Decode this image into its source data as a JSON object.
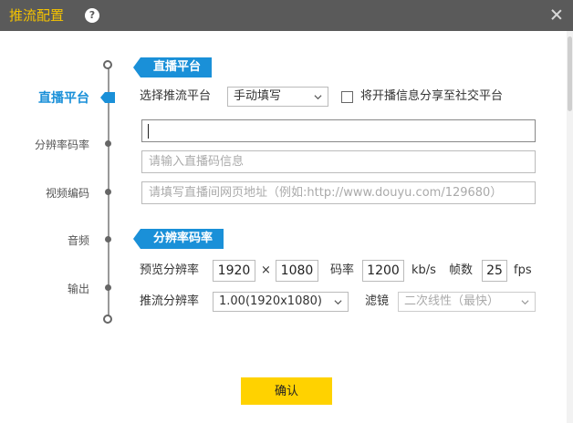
{
  "window": {
    "title": "推流配置",
    "help_glyph": "?"
  },
  "nav": {
    "items": [
      {
        "label": "直播平台",
        "active": true
      },
      {
        "label": "分辨率码率",
        "active": false
      },
      {
        "label": "视频编码",
        "active": false
      },
      {
        "label": "音频",
        "active": false
      },
      {
        "label": "输出",
        "active": false
      }
    ]
  },
  "platform_section": {
    "tag": "直播平台",
    "select_label": "选择推流平台",
    "select_value": "手动填写",
    "share_label": "将开播信息分享至社交平台",
    "share_checked": false,
    "server_input_value": "",
    "stream_key_placeholder": "请输入直播码信息",
    "room_url_placeholder": "请填写直播间网页地址（例如:http://www.douyu.com/129680）"
  },
  "resolution_section": {
    "tag": "分辨率码率",
    "preview_label": "预览分辨率",
    "preview_width": "1920",
    "times_sign": "×",
    "preview_height": "1080",
    "bitrate_label": "码率",
    "bitrate_value": "1200",
    "bitrate_unit": "kb/s",
    "fps_label": "帧数",
    "fps_value": "25",
    "fps_unit": "fps",
    "stream_res_label": "推流分辨率",
    "stream_res_value": "1.00(1920x1080)",
    "filter_label": "滤镜",
    "filter_value": "二次线性（最快）"
  },
  "footer": {
    "confirm_label": "确认"
  },
  "colors": {
    "titlebar": "#5a5a5a",
    "title_text": "#f5c300",
    "accent": "#1a90d8",
    "confirm_button": "#ffd200"
  }
}
